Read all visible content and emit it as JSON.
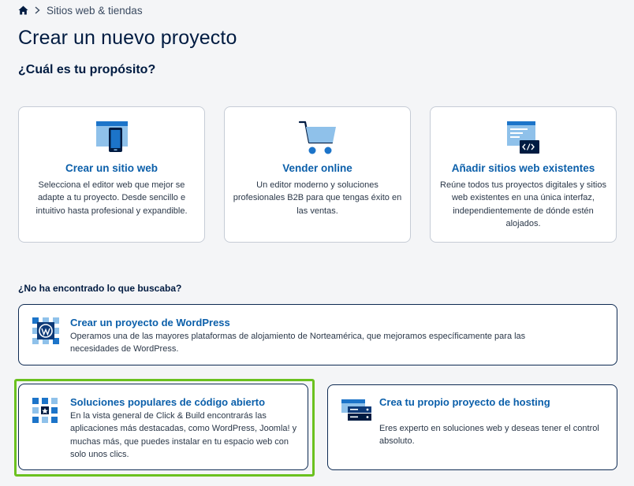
{
  "breadcrumb": {
    "home_icon": "home-icon",
    "separator_icon": "chevron-right-icon",
    "current": "Sitios web & tiendas"
  },
  "page": {
    "title": "Crear un nuevo proyecto",
    "subtitle": "¿Cuál es tu propósito?"
  },
  "cards": [
    {
      "icon": "website-device-icon",
      "title": "Crear un sitio web",
      "description": "Selecciona el editor web que mejor se adapte a tu proyecto. Desde sencillo e intuitivo hasta profesional y expandible."
    },
    {
      "icon": "shopping-cart-icon",
      "title": "Vender online",
      "description": "Un editor moderno y soluciones profesionales B2B para que tengas éxito en las ventas."
    },
    {
      "icon": "code-window-icon",
      "title": "Añadir sitios web existentes",
      "description": "Reúne todos tus proyectos digitales y sitios web existentes en una única interfaz, independientemente de dónde estén alojados."
    }
  ],
  "more": {
    "label": "¿No ha encontrado lo que buscaba?",
    "wordpress": {
      "icon": "wordpress-icon",
      "title": "Crear un proyecto de WordPress",
      "description": "Operamos una de las mayores plataformas de alojamiento de Norteamérica, que mejoramos específicamente para las necesidades de WordPress."
    },
    "opensource": {
      "icon": "app-grid-icon",
      "title": "Soluciones populares de código abierto",
      "description": "En la vista general de Click & Build encontrarás las aplicaciones más destacadas, como WordPress, Joomla! y muchas más, que puedes instalar en tu espacio web con solo unos clics."
    },
    "hosting": {
      "icon": "server-icon",
      "title": "Crea tu propio proyecto de hosting",
      "description": "Eres experto en soluciones web y deseas tener el control absoluto."
    }
  },
  "colors": {
    "accent": "#0b5faa",
    "navy": "#001b41",
    "highlight": "#6bc11f",
    "icon_blue": "#1c74c9",
    "icon_light": "#8fc1ea"
  }
}
